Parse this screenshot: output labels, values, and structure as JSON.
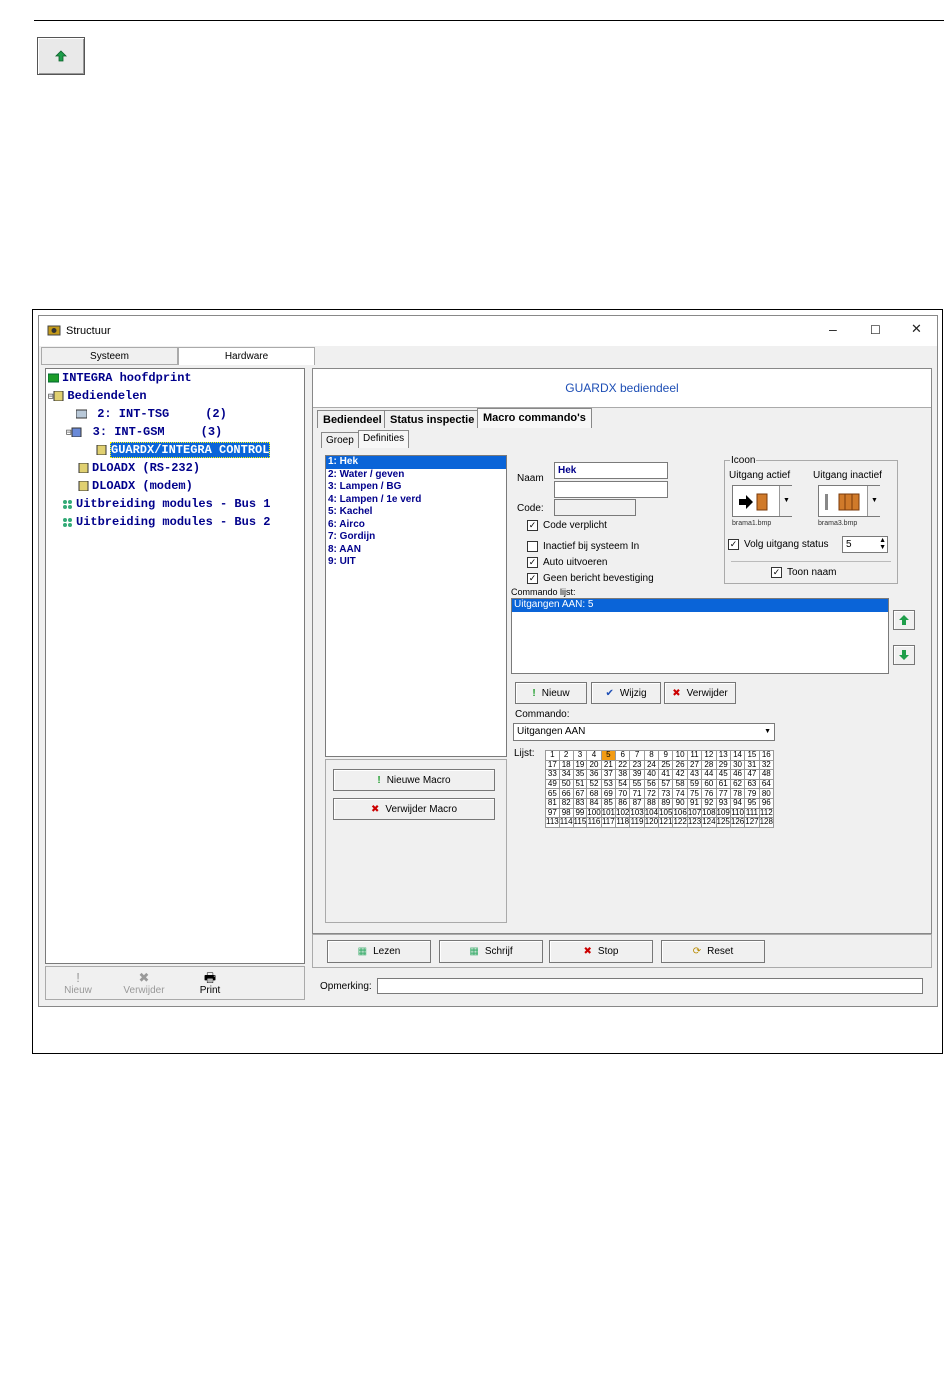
{
  "window": {
    "title": "Structuur",
    "min": "–",
    "max": "☐",
    "close": "✕"
  },
  "left_tabs": [
    "Systeem",
    "Hardware"
  ],
  "tree": [
    {
      "text": "INTEGRA hoofdprint",
      "icon": "mainboard-icon"
    },
    {
      "text": "Bediendelen",
      "icon": "keypad-group-icon"
    },
    {
      "text": "2: INT-TSG     (2)",
      "icon": "tsg-icon"
    },
    {
      "text": "3: INT-GSM     (3)",
      "icon": "gsm-icon"
    },
    {
      "text": "GUARDX/INTEGRA CONTROL",
      "icon": "guardx-icon"
    },
    {
      "text": "DLOADX (RS-232)",
      "icon": "dloadx-icon"
    },
    {
      "text": "DLOADX (modem)",
      "icon": "dloadx-icon"
    },
    {
      "text": "Uitbreiding modules - Bus 1",
      "icon": "bus-icon"
    },
    {
      "text": "Uitbreiding modules - Bus 2",
      "icon": "bus-icon"
    }
  ],
  "left_tools": {
    "new": "Nieuw",
    "delete": "Verwijder",
    "print": "Print"
  },
  "header": {
    "title": "GUARDX bediendeel"
  },
  "main_tabs": [
    "Bediendeel",
    "Status inspectie",
    "Macro commando's"
  ],
  "sub_tabs": [
    "Groep",
    "Definities"
  ],
  "macros": [
    "1: Hek",
    "2: Water / geven",
    "3: Lampen / BG",
    "4: Lampen /  1e verd",
    "5: Kachel",
    "6: Airco",
    "7: Gordijn",
    "8: AAN",
    "9: UIT"
  ],
  "macro_buttons": {
    "new": "Nieuwe Macro",
    "delete": "Verwijder Macro"
  },
  "form": {
    "naam_label": "Naam",
    "naam_value": "Hek",
    "naam_value2": "",
    "code_label": "Code:",
    "code_value": "",
    "code_verplicht": "Code verplicht",
    "inactief": "Inactief bij systeem In",
    "auto": "Auto uitvoeren",
    "geen_bericht": "Geen bericht bevestiging"
  },
  "icon_group": {
    "title": "Icoon",
    "active_label": "Uitgang actief",
    "inactive_label": "Uitgang inactief",
    "active_file": "brama1.bmp",
    "inactive_file": "brama3.bmp",
    "follow_label": "Volg uitgang status",
    "follow_value": "5",
    "show_name": "Toon naam"
  },
  "command_list": {
    "label": "Commando lijst:",
    "items": [
      "Uitgangen AAN: 5"
    ]
  },
  "command_buttons": {
    "new": "Nieuw",
    "edit": "Wijzig",
    "delete": "Verwijder"
  },
  "commando": {
    "label": "Commando:",
    "value": "Uitgangen AAN"
  },
  "list": {
    "label": "Lijst:",
    "selected": [
      5
    ],
    "max": 128
  },
  "bottom_buttons": {
    "read": "Lezen",
    "write": "Schrijf",
    "stop": "Stop",
    "reset": "Reset"
  },
  "remark": {
    "label": "Opmerking:",
    "value": ""
  },
  "colors": {
    "accent": "#0a64d8",
    "tree_text": "#00008b",
    "header_text": "#1d4eb5",
    "cell_selected": "#f29b13"
  }
}
